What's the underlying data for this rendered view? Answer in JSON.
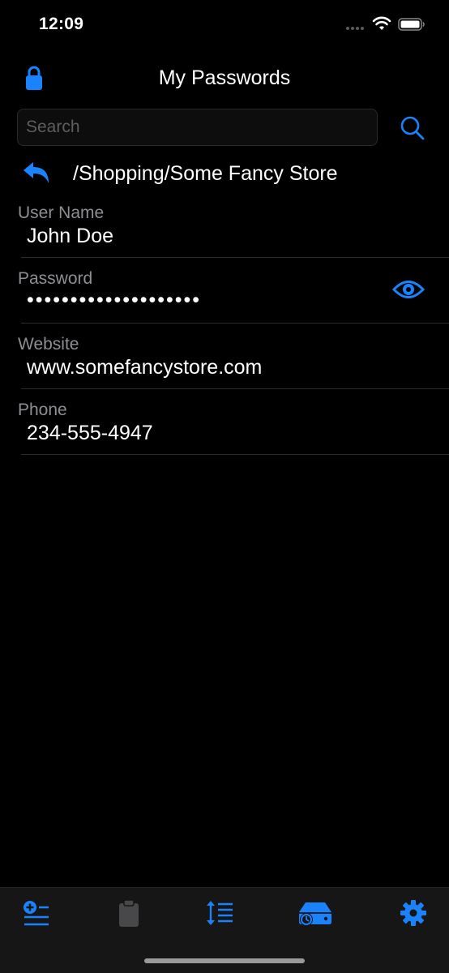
{
  "status_bar": {
    "time": "12:09"
  },
  "header": {
    "title": "My Passwords"
  },
  "search": {
    "placeholder": "Search",
    "value": ""
  },
  "breadcrumb": {
    "path": "/Shopping/Some Fancy Store"
  },
  "fields": [
    {
      "label": "User Name",
      "value": "John Doe"
    },
    {
      "label": "Password",
      "value": "••••••••••••••••••••"
    },
    {
      "label": "Website",
      "value": "www.somefancystore.com"
    },
    {
      "label": "Phone",
      "value": "234-555-4947"
    }
  ],
  "tab_bar": {
    "tabs": [
      "add-entry-icon",
      "clipboard-icon",
      "sort-icon",
      "backup-restore-icon",
      "settings-gear-icon"
    ]
  },
  "colors": {
    "accent": "#1a82fb",
    "background": "#000000",
    "label_gray": "#8e8e93",
    "tab_bar_bg": "#161616",
    "disabled_gray": "#48484a"
  }
}
